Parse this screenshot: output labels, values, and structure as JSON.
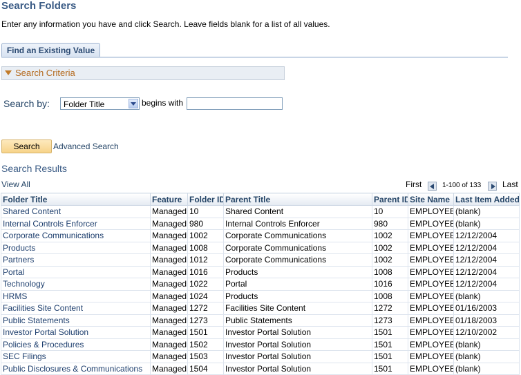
{
  "page": {
    "title": "Search Folders",
    "instructions": "Enter any information you have and click Search. Leave fields blank for a list of all values."
  },
  "tabs": [
    {
      "label": "Find an Existing Value"
    }
  ],
  "criteria": {
    "header": "Search Criteria",
    "search_by_label": "Search by:",
    "field_select": {
      "selected": "Folder Title"
    },
    "operator": "begins with",
    "value_input": {
      "value": "",
      "placeholder": ""
    }
  },
  "buttons": {
    "search": "Search",
    "advanced_search": "Advanced Search"
  },
  "results": {
    "title": "Search Results",
    "view_all": "View All",
    "nav": {
      "first": "First",
      "range": "1-100 of 133",
      "last": "Last"
    },
    "columns": [
      "Folder Title",
      "Feature",
      "Folder ID",
      "Parent Title",
      "Parent ID",
      "Site Name",
      "Last Item Added"
    ],
    "rows": [
      [
        "Shared Content",
        "Managed",
        "10",
        "Shared Content",
        "10",
        "EMPLOYEE",
        "(blank)"
      ],
      [
        "Internal Controls Enforcer",
        "Managed",
        "980",
        "Internal Controls Enforcer",
        "980",
        "EMPLOYEE",
        "(blank)"
      ],
      [
        "Corporate Communications",
        "Managed",
        "1002",
        "Corporate Communications",
        "1002",
        "EMPLOYEE",
        "12/12/2004"
      ],
      [
        "Products",
        "Managed",
        "1008",
        "Corporate Communications",
        "1002",
        "EMPLOYEE",
        "12/12/2004"
      ],
      [
        "Partners",
        "Managed",
        "1012",
        "Corporate Communications",
        "1002",
        "EMPLOYEE",
        "12/12/2004"
      ],
      [
        "Portal",
        "Managed",
        "1016",
        "Products",
        "1008",
        "EMPLOYEE",
        "12/12/2004"
      ],
      [
        "Technology",
        "Managed",
        "1022",
        "Portal",
        "1016",
        "EMPLOYEE",
        "12/12/2004"
      ],
      [
        "HRMS",
        "Managed",
        "1024",
        "Products",
        "1008",
        "EMPLOYEE",
        "(blank)"
      ],
      [
        "Facilities Site Content",
        "Managed",
        "1272",
        "Facilities Site Content",
        "1272",
        "EMPLOYEE",
        "01/16/2003"
      ],
      [
        "Public Statements",
        "Managed",
        "1273",
        "Public Statements",
        "1273",
        "EMPLOYEE",
        "01/18/2003"
      ],
      [
        "Investor Portal Solution",
        "Managed",
        "1501",
        "Investor Portal Solution",
        "1501",
        "EMPLOYEE",
        "12/10/2002"
      ],
      [
        "Policies & Procedures",
        "Managed",
        "1502",
        "Investor Portal Solution",
        "1501",
        "EMPLOYEE",
        "(blank)"
      ],
      [
        "SEC Filings",
        "Managed",
        "1503",
        "Investor Portal Solution",
        "1501",
        "EMPLOYEE",
        "(blank)"
      ],
      [
        "Public Disclosures & Communications",
        "Managed",
        "1504",
        "Investor Portal Solution",
        "1501",
        "EMPLOYEE",
        "(blank)"
      ]
    ]
  },
  "colors": {
    "title": "#3a5b85",
    "link": "#1e3f6e",
    "criteria_accent": "#b46a1e",
    "search_button": "#f7d389"
  },
  "icons": {
    "criteria_toggle": "collapse-triangle-icon",
    "select_dropdown": "chevron-down-icon",
    "prev_page": "arrow-left-icon",
    "next_page": "arrow-right-icon"
  }
}
